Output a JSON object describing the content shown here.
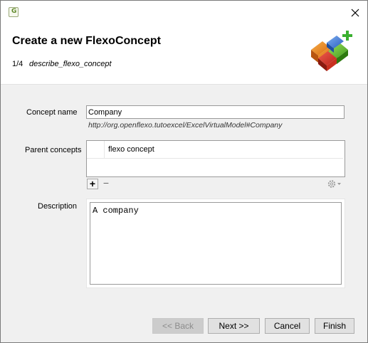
{
  "window": {
    "app_icon": "flexo-app-icon",
    "close_icon": "close-icon"
  },
  "header": {
    "title": "Create a new FlexoConcept",
    "step_number": "1/4",
    "step_name": "describe_flexo_concept",
    "banner_icon": "flexo-concept-add-icon"
  },
  "form": {
    "concept_name_label": "Concept name",
    "concept_name_value": "Company",
    "concept_uri": "http://org.openflexo.tutoexcel/ExcelVirtualModel#Company",
    "parent_concepts_label": "Parent concepts",
    "parent_concepts": [
      {
        "name": "flexo concept"
      }
    ],
    "add_label": "+",
    "remove_label": "−",
    "settings_icon": "gear-icon",
    "description_label": "Description",
    "description_value": "A company"
  },
  "buttons": {
    "back": "<< Back",
    "next": "Next >>",
    "cancel": "Cancel",
    "finish": "Finish"
  }
}
